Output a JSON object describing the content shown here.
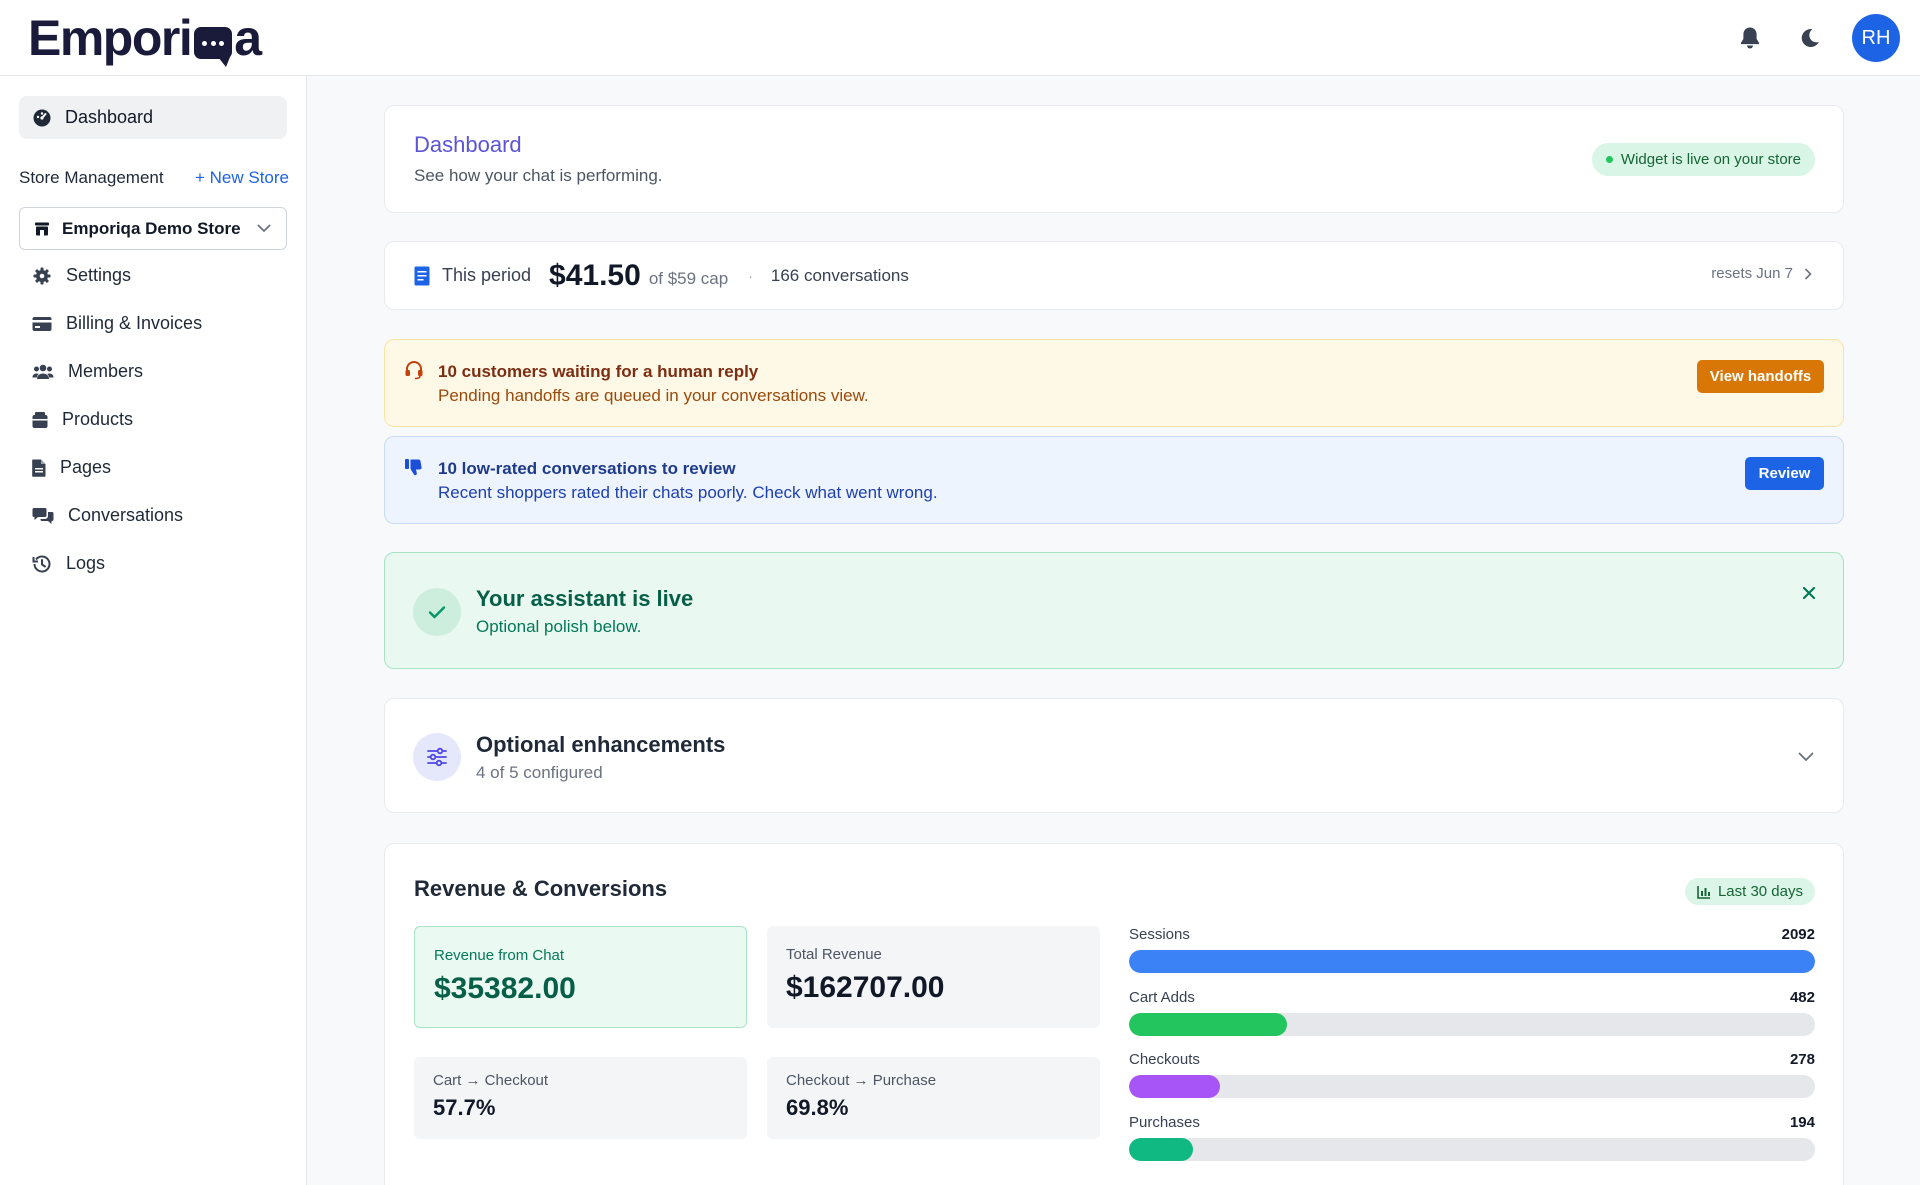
{
  "brand": {
    "logo_left": "Empori",
    "logo_right": "a"
  },
  "header": {
    "avatar_initials": "RH"
  },
  "sidebar": {
    "active_item": "Dashboard",
    "section_title": "Store Management",
    "new_store_label": "+ New Store",
    "store_selected": "Emporiqa Demo Store",
    "items": [
      "Settings",
      "Billing & Invoices",
      "Members",
      "Products",
      "Pages",
      "Conversations",
      "Logs"
    ]
  },
  "dashboard": {
    "title": "Dashboard",
    "subtitle": "See how your chat is performing.",
    "status_badge": "Widget is live on your store"
  },
  "period": {
    "label": "This period",
    "amount": "$41.50",
    "cap": "of $59 cap",
    "separator": "·",
    "conversations": "166 conversations",
    "resets": "resets Jun 7"
  },
  "alerts": {
    "handoff": {
      "title": "10 customers waiting for a human reply",
      "text": "Pending handoffs are queued in your conversations view.",
      "button": "View handoffs"
    },
    "review": {
      "title": "10 low-rated conversations to review",
      "text": "Recent shoppers rated their chats poorly. Check what went wrong.",
      "button": "Review"
    }
  },
  "assistant": {
    "title": "Your assistant is live",
    "subtitle": "Optional polish below."
  },
  "enhancements": {
    "title": "Optional enhancements",
    "subtitle": "4 of 5 configured"
  },
  "revenue": {
    "title": "Revenue & Conversions",
    "range": "Last 30 days",
    "kpis": {
      "chat_revenue_label": "Revenue from Chat",
      "chat_revenue_value": "$35382.00",
      "total_revenue_label": "Total Revenue",
      "total_revenue_value": "$162707.00",
      "cart_checkout_label": "Cart → Checkout",
      "cart_checkout_value": "57.7%",
      "checkout_purchase_label": "Checkout → Purchase",
      "checkout_purchase_value": "69.8%"
    },
    "funnel": [
      {
        "label": "Sessions",
        "value": 2092,
        "color": "#3b82f6"
      },
      {
        "label": "Cart Adds",
        "value": 482,
        "color": "#22c55e"
      },
      {
        "label": "Checkouts",
        "value": 278,
        "color": "#a855f7"
      },
      {
        "label": "Purchases",
        "value": 194,
        "color": "#10b981"
      }
    ]
  },
  "colors": {
    "primary": "#1d63e6",
    "brand_purple": "#5b54d6",
    "warning": "#d97706",
    "success": "#22c55e"
  }
}
